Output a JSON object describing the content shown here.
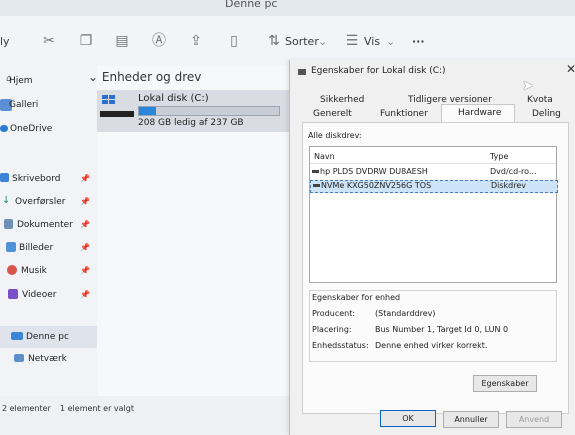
{
  "window": {
    "title": "Denne pc"
  },
  "toolbar": {
    "new_partial": "ly",
    "sort_label": "Sorter",
    "view_label": "Vis",
    "more_label": "···"
  },
  "nav": {
    "items": [
      {
        "label": "Hjem"
      },
      {
        "label": "Galleri"
      },
      {
        "label": "OneDrive"
      },
      {
        "label": "Skrivebord"
      },
      {
        "label": "Overførsler"
      },
      {
        "label": "Dokumenter"
      },
      {
        "label": "Billeder"
      },
      {
        "label": "Musik"
      },
      {
        "label": "Videoer"
      },
      {
        "label": "Denne pc"
      },
      {
        "label": "Netværk"
      }
    ]
  },
  "content": {
    "group_header": "Enheder og drev",
    "drive": {
      "name": "Lokal disk (C:)",
      "space": "208 GB ledig af 237 GB",
      "usage_fraction": 0.12
    }
  },
  "status": {
    "items_count": "2 elementer",
    "selected": "1 element er valgt"
  },
  "dialog": {
    "title": "Egenskaber for Lokal disk (C:)",
    "tabs_row1": [
      "Sikkerhed",
      "Tidligere versioner",
      "Kvota"
    ],
    "tabs_row2": [
      "Generelt",
      "Funktioner",
      "Hardware",
      "Deling"
    ],
    "selected_tab": "Hardware",
    "all_drives_label": "Alle diskdrev:",
    "list_headers": {
      "name": "Navn",
      "type": "Type"
    },
    "drives": [
      {
        "name": "hp PLDS DVDRW  DU8AESH",
        "type": "Dvd/cd-ro..."
      },
      {
        "name": "NVMe KXG50ZNV256G TOS",
        "type": "Diskdrev"
      }
    ],
    "device_props": {
      "legend": "Egenskaber for enhed",
      "producer_label": "Producent:",
      "producer_value": "(Standarddrev)",
      "location_label": "Placering:",
      "location_value": "Bus Number 1, Target Id 0, LUN 0",
      "status_label": "Enhedsstatus:",
      "status_value": "Denne enhed virker korrekt."
    },
    "properties_button": "Egenskaber",
    "ok_button": "OK",
    "cancel_button": "Annuller",
    "apply_button": "Anvend"
  }
}
